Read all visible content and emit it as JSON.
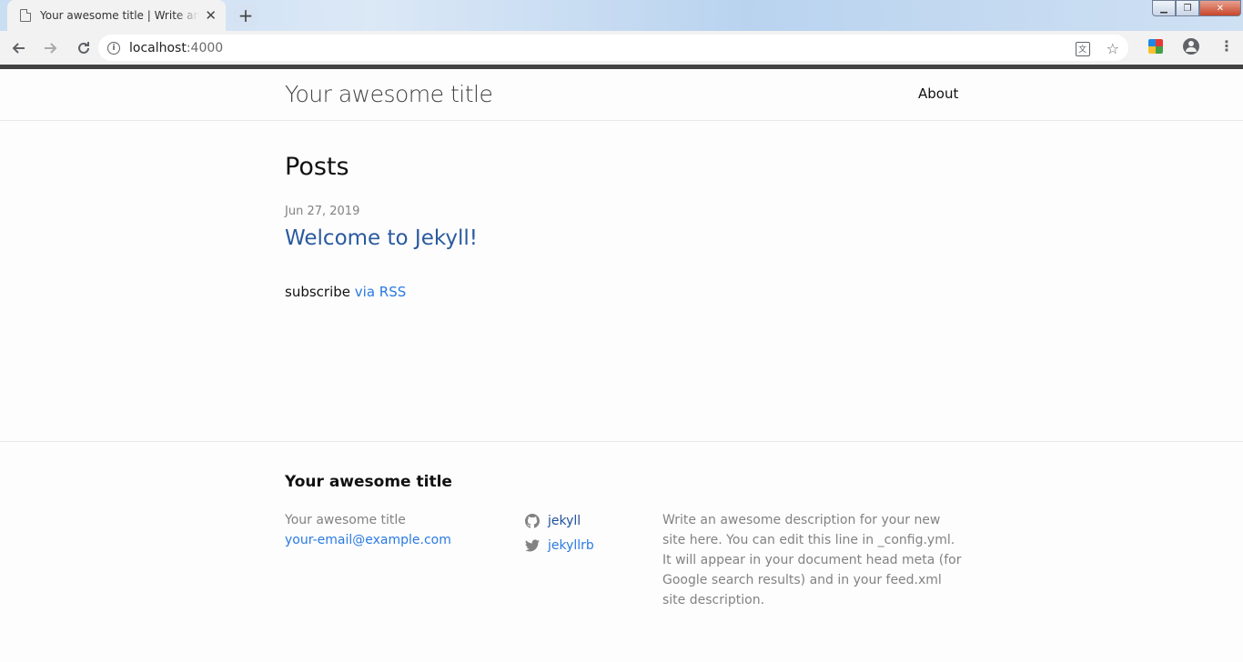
{
  "browser": {
    "tab_title": "Your awesome title | Write an awesome description for your new site",
    "tab_close": "✕",
    "new_tab": "+",
    "url_host": "localhost",
    "url_port": ":4000",
    "window_controls": {
      "minimize": "▁",
      "restore": "❐",
      "close": "✕"
    }
  },
  "header": {
    "site_title": "Your awesome title",
    "nav": [
      {
        "label": "About"
      }
    ]
  },
  "main": {
    "heading": "Posts",
    "posts": [
      {
        "date": "Jun 27, 2019",
        "title": "Welcome to Jekyll!"
      }
    ],
    "rss_prefix": "subscribe",
    "rss_link": "via RSS"
  },
  "footer": {
    "heading": "Your awesome title",
    "name": "Your awesome title",
    "email": "your-email@example.com",
    "social": [
      {
        "icon": "github-icon",
        "label": "jekyll"
      },
      {
        "icon": "twitter-icon",
        "label": "jekyllrb"
      }
    ],
    "description": "Write an awesome description for your new site here. You can edit this line in _config.yml. It will appear in your document head meta (for Google search results) and in your feed.xml site description."
  },
  "colors": {
    "link": "#2a7ae2",
    "text": "#111111",
    "meta": "#828282",
    "top_border": "#424242"
  }
}
